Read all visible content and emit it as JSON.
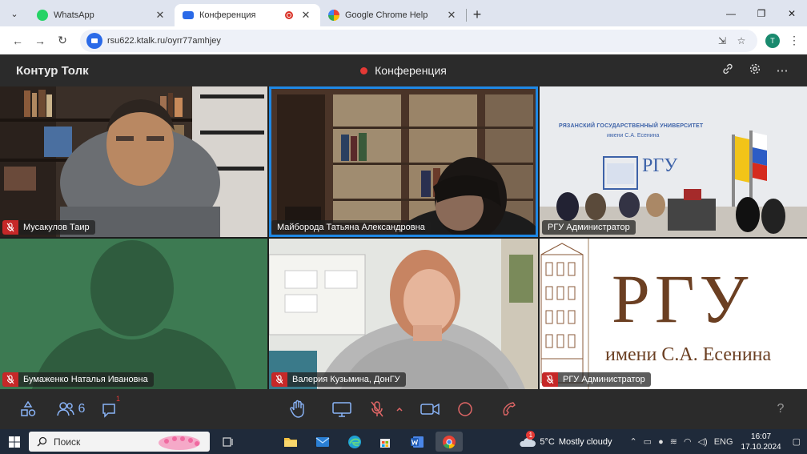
{
  "browser": {
    "tabs": [
      {
        "title": "WhatsApp",
        "color": "#25d366",
        "active": false
      },
      {
        "title": "Конференция",
        "color": "#2a6ae8",
        "active": true,
        "recording": true
      },
      {
        "title": "Google Chrome Help",
        "color": "#4285f4",
        "active": false
      }
    ],
    "url": "rsu622.ktalk.ru/oyrr77amhjey",
    "profile_initial": "T"
  },
  "app": {
    "brand": "Контур Толк",
    "conference_title": "Конференция",
    "accent": "#1e88e5",
    "mute_color": "#c62828"
  },
  "participants": [
    {
      "name": "Мусакулов Таир",
      "muted": true,
      "highlighted": false,
      "kind": "camera"
    },
    {
      "name": "Майборода Татьяна Александровна",
      "muted": false,
      "highlighted": true,
      "kind": "camera"
    },
    {
      "name": "РГУ Администратор",
      "muted": false,
      "highlighted": false,
      "kind": "camera"
    },
    {
      "name": "Бумаженко Наталья Ивановна",
      "muted": true,
      "highlighted": false,
      "kind": "avatar"
    },
    {
      "name": "Валерия Кузьмина, ДонГУ",
      "muted": true,
      "highlighted": false,
      "kind": "camera"
    },
    {
      "name": "РГУ Администратор",
      "muted": true,
      "highlighted": false,
      "kind": "screen"
    }
  ],
  "room_scene": {
    "banner_line1": "РЯЗАНСКИЙ ГОСУДАРСТВЕННЫЙ УНИВЕРСИТЕТ",
    "banner_line2": "имени С.А. Есенина",
    "banner_logo": "РГУ"
  },
  "screen_share": {
    "logo": "РГУ",
    "subtitle": "имени С.А. Есенина"
  },
  "controls": {
    "participants_count": "6",
    "chat_badge": "1",
    "help": "?"
  },
  "taskbar": {
    "search_placeholder": "Поиск",
    "weather_temp": "5°C",
    "weather_text": "Mostly cloudy",
    "weather_badge": "1",
    "lang": "ENG",
    "time": "16:07",
    "date": "17.10.2024"
  }
}
